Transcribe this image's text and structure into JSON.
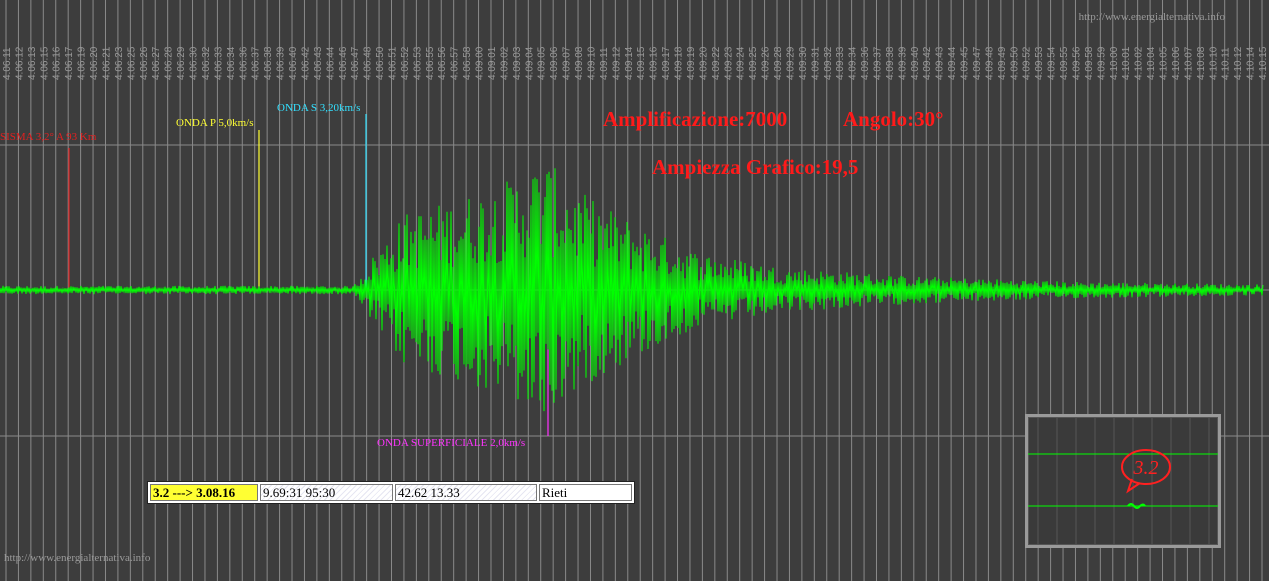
{
  "watermark": "http://www.energialternativa.info",
  "headline": {
    "amplification": "Amplificazione:7000",
    "angle": "Angolo:30°",
    "graph_range": "Ampiezza Grafico:19,5"
  },
  "markers": {
    "quake": "SISMA 3,2° A 93 Km",
    "p_wave": "ONDA P 5,0km/s",
    "s_wave": "ONDA S 3,20km/s",
    "surface_wave": "ONDA SUPERFICIALE 2,0km/s"
  },
  "info": {
    "magnitude": "3.2 ---> 3.08.16",
    "time": "9.69:31 95:30",
    "coords": "42.62 13.33",
    "place": "Rieti"
  },
  "thumbnail": {
    "badge": "3.2"
  },
  "colors": {
    "background": "#3d3d3d",
    "trace": "#00ff00",
    "grid": "#8a8a8a",
    "quake_marker": "#e02020",
    "p_marker": "#ffff33",
    "s_marker": "#33e0ff",
    "surface_marker": "#ff33ff"
  },
  "chart_data": {
    "type": "line",
    "title": "",
    "xlabel": "",
    "ylabel": "",
    "x_tick_labels": [
      "4.06.11",
      "4.06.12",
      "4.06.13",
      "4.06.15",
      "4.06.16",
      "4.06.17",
      "4.06.19",
      "4.06.20",
      "4.06.21",
      "4.06.23",
      "4.06.25",
      "4.06.26",
      "4.06.27",
      "4.06.28",
      "4.06.29",
      "4.06.30",
      "4.06.32",
      "4.06.33",
      "4.06.34",
      "4.06.36",
      "4.06.37",
      "4.06.38",
      "4.06.39",
      "4.06.40",
      "4.06.42",
      "4.06.43",
      "4.06.44",
      "4.06.46",
      "4.06.47",
      "4.06.48",
      "4.06.50",
      "4.06.51",
      "4.06.52",
      "4.06.53",
      "4.06.55",
      "4.06.56",
      "4.06.57",
      "4.06.58",
      "4.09.00",
      "4.09.01",
      "4.09.02",
      "4.09.03",
      "4.09.04",
      "4.09.05",
      "4.09.06",
      "4.09.07",
      "4.09.08",
      "4.09.10",
      "4.09.11",
      "4.09.12",
      "4.09.14",
      "4.09.15",
      "4.09.16",
      "4.09.17",
      "4.09.18",
      "4.09.19",
      "4.09.20",
      "4.09.22",
      "4.09.23",
      "4.09.24",
      "4.09.25",
      "4.09.26",
      "4.09.28",
      "4.09.29",
      "4.09.30",
      "4.09.31",
      "4.09.32",
      "4.09.33",
      "4.09.34",
      "4.09.36",
      "4.09.37",
      "4.09.38",
      "4.09.39",
      "4.09.40",
      "4.09.42",
      "4.09.43",
      "4.09.44",
      "4.09.45",
      "4.09.47",
      "4.09.48",
      "4.09.49",
      "4.09.50",
      "4.09.52",
      "4.09.53",
      "4.09.54",
      "4.09.55",
      "4.09.56",
      "4.09.58",
      "4.09.59",
      "4.10.00",
      "4.10.01",
      "4.10.02",
      "4.10.04",
      "4.10.05",
      "4.10.06",
      "4.10.07",
      "4.10.08",
      "4.10.10",
      "4.10.11",
      "4.10.12",
      "4.10.14",
      "4.10.15"
    ],
    "series": [
      {
        "envelope": [
          {
            "t": 0.0,
            "a": 0.03
          },
          {
            "t": 0.28,
            "a": 0.03
          },
          {
            "t": 0.29,
            "a": 0.18
          },
          {
            "t": 0.32,
            "a": 0.55
          },
          {
            "t": 0.36,
            "a": 0.65
          },
          {
            "t": 0.4,
            "a": 0.78
          },
          {
            "t": 0.43,
            "a": 0.95
          },
          {
            "t": 0.46,
            "a": 0.7
          },
          {
            "t": 0.5,
            "a": 0.5
          },
          {
            "t": 0.55,
            "a": 0.28
          },
          {
            "t": 0.62,
            "a": 0.16
          },
          {
            "t": 0.72,
            "a": 0.1
          },
          {
            "t": 0.85,
            "a": 0.06
          },
          {
            "t": 1.0,
            "a": 0.04
          }
        ]
      }
    ]
  }
}
